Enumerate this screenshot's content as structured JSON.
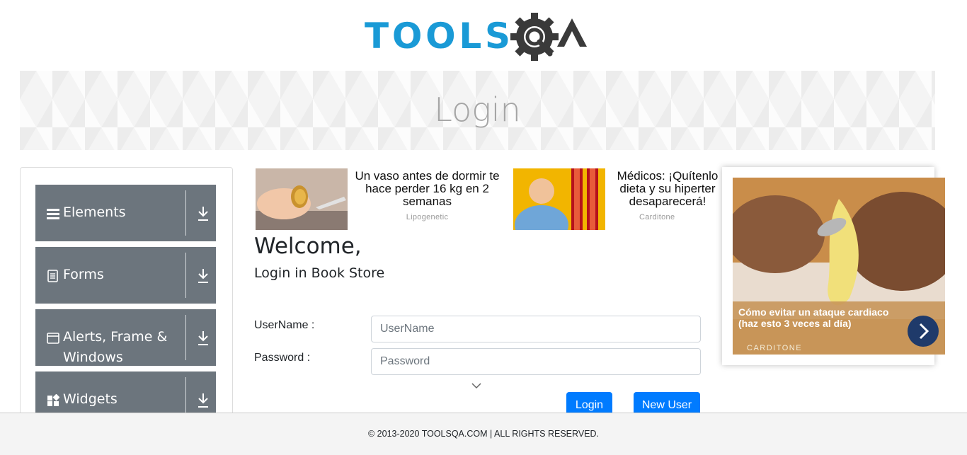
{
  "header": {
    "logo_text": "TOOLSQA",
    "logo_icon": "gear-magnifier-icon"
  },
  "banner": {
    "title": "Login"
  },
  "sidebar": {
    "items": [
      {
        "label": "Elements",
        "icon": "hamburger-icon"
      },
      {
        "label": "Forms",
        "icon": "document-icon"
      },
      {
        "label": "Alerts, Frame &",
        "label2": "Windows",
        "icon": "window-icon"
      },
      {
        "label": "Widgets",
        "icon": "widgets-icon"
      }
    ]
  },
  "ads": [
    {
      "title": "Un vaso antes de dormir te hace perder 16 kg en 2 semanas",
      "source": "Lipogenetic"
    },
    {
      "title": "Médicos: ¡Quítenlo dieta y su hiperter desaparecerá!",
      "source": "Carditone"
    }
  ],
  "video_ad": {
    "caption": "Cómo evitar un ataque cardiaco (haz esto 3 veces al día)",
    "brand": "CARDITONE"
  },
  "login": {
    "welcome": "Welcome,",
    "subtitle": "Login in Book Store",
    "username_label": "UserName :",
    "username_placeholder": "UserName",
    "password_label": "Password :",
    "password_placeholder": "Password",
    "login_button": "Login",
    "new_user_button": "New User"
  },
  "footer": {
    "text": "© 2013-2020 TOOLSQA.COM | ALL RIGHTS RESERVED."
  },
  "colors": {
    "accent": "#007bff",
    "menu_bg": "#6c757d",
    "logo_blue": "#1a9ad6",
    "logo_dark": "#3a3a3a"
  }
}
